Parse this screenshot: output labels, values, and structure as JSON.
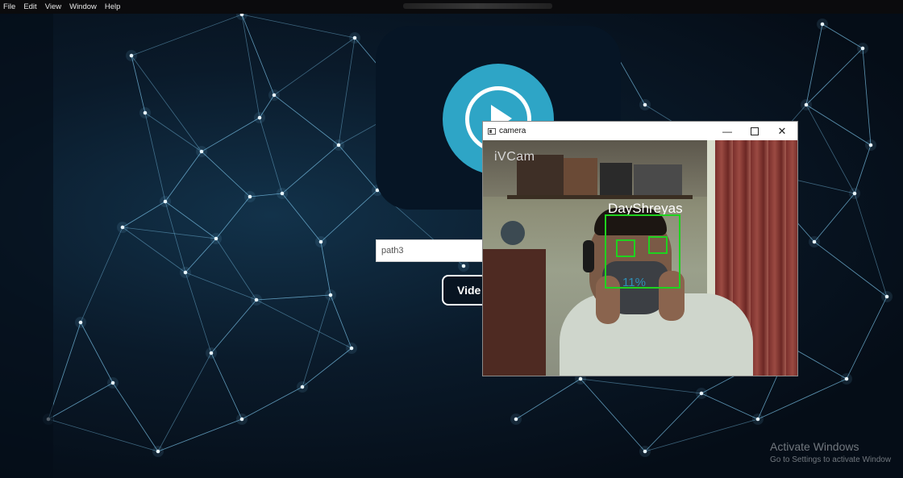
{
  "menubar": {
    "items": [
      "File",
      "Edit",
      "View",
      "Window",
      "Help"
    ]
  },
  "app": {
    "path_input": {
      "value": "path3"
    },
    "video_button_label": "Vide"
  },
  "camera_window": {
    "title": "camera",
    "controls": {
      "minimize": "—",
      "close": "✕"
    },
    "overlay": {
      "watermark": "iVCam",
      "face_label": "DayShreyas",
      "confidence": "11%",
      "box_color": "#1fd21f"
    }
  },
  "system": {
    "activation_title": "Activate Windows",
    "activation_subtitle": "Go to Settings to activate Window"
  },
  "colors": {
    "accent": "#2ea5c6",
    "card": "#061525",
    "network": "#7fc8ee"
  }
}
